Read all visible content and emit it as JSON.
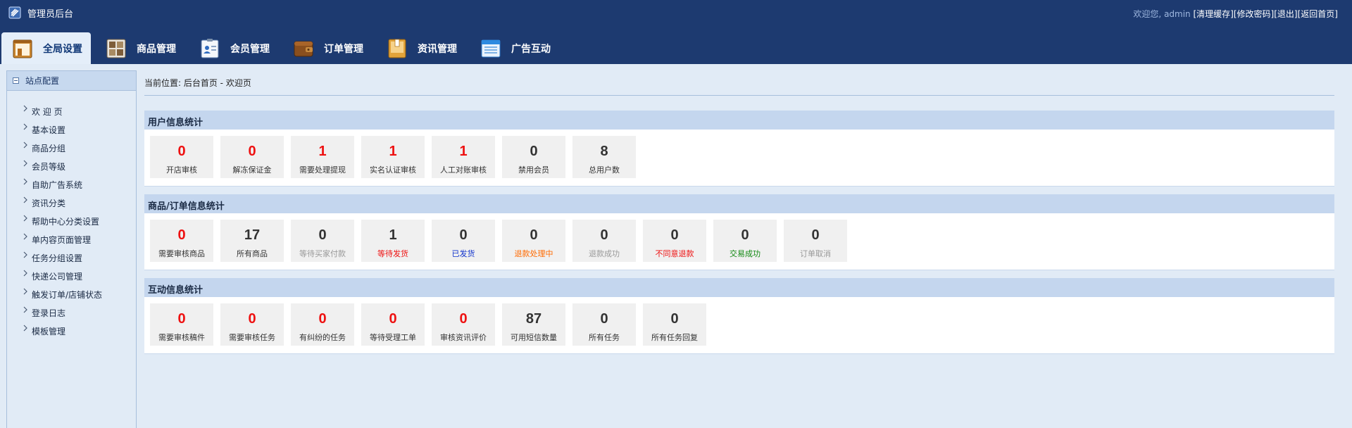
{
  "header": {
    "title": "管理员后台",
    "welcome_prefix": "欢迎您,",
    "username": "admin",
    "links": [
      {
        "label": "[清理缓存]"
      },
      {
        "label": "[修改密码]"
      },
      {
        "label": "[退出]"
      },
      {
        "label": "[返回首页]"
      }
    ]
  },
  "nav": {
    "tabs": [
      {
        "label": "全局设置",
        "icon": "global-settings-icon",
        "active": true
      },
      {
        "label": "商品管理",
        "icon": "product-grid-icon"
      },
      {
        "label": "会员管理",
        "icon": "member-card-icon"
      },
      {
        "label": "订单管理",
        "icon": "order-wallet-icon"
      },
      {
        "label": "资讯管理",
        "icon": "news-folder-icon"
      },
      {
        "label": "广告互动",
        "icon": "ad-window-icon"
      }
    ]
  },
  "sidebar": {
    "title": "站点配置",
    "items": [
      {
        "label": "欢 迎 页"
      },
      {
        "label": "基本设置"
      },
      {
        "label": "商品分组"
      },
      {
        "label": "会员等级"
      },
      {
        "label": "自助广告系统"
      },
      {
        "label": "资讯分类"
      },
      {
        "label": "帮助中心分类设置"
      },
      {
        "label": "单内容页面管理"
      },
      {
        "label": "任务分组设置"
      },
      {
        "label": "快递公司管理"
      },
      {
        "label": "触发订单/店铺状态"
      },
      {
        "label": "登录日志"
      },
      {
        "label": "模板管理"
      }
    ]
  },
  "breadcrumb": "当前位置: 后台首页 - 欢迎页",
  "colors": {
    "header_bg": "#1d3a70",
    "page_bg": "#e1ebf6",
    "panel_head_bg": "#c4d6ee",
    "num_red": "#ee1111",
    "num_dark": "#333333"
  },
  "panels": [
    {
      "title": "用户信息统计",
      "cards": [
        {
          "value": "0",
          "label": "开店审核",
          "num_color": "#ee1111",
          "label_color": "#333333"
        },
        {
          "value": "0",
          "label": "解冻保证金",
          "num_color": "#ee1111",
          "label_color": "#333333"
        },
        {
          "value": "1",
          "label": "需要处理提现",
          "num_color": "#ee1111",
          "label_color": "#333333"
        },
        {
          "value": "1",
          "label": "实名认证审核",
          "num_color": "#ee1111",
          "label_color": "#333333"
        },
        {
          "value": "1",
          "label": "人工对账审核",
          "num_color": "#ee1111",
          "label_color": "#333333"
        },
        {
          "value": "0",
          "label": "禁用会员",
          "num_color": "#333333",
          "label_color": "#333333"
        },
        {
          "value": "8",
          "label": "总用户数",
          "num_color": "#333333",
          "label_color": "#333333"
        }
      ]
    },
    {
      "title": "商品/订单信息统计",
      "cards": [
        {
          "value": "0",
          "label": "需要审核商品",
          "num_color": "#ee1111",
          "label_color": "#333333"
        },
        {
          "value": "17",
          "label": "所有商品",
          "num_color": "#333333",
          "label_color": "#333333"
        },
        {
          "value": "0",
          "label": "等待买家付款",
          "num_color": "#333333",
          "label_color": "#999999"
        },
        {
          "value": "1",
          "label": "等待发货",
          "num_color": "#333333",
          "label_color": "#ee1111"
        },
        {
          "value": "0",
          "label": "已发货",
          "num_color": "#333333",
          "label_color": "#1133cc"
        },
        {
          "value": "0",
          "label": "退款处理中",
          "num_color": "#333333",
          "label_color": "#ff6a00"
        },
        {
          "value": "0",
          "label": "退款成功",
          "num_color": "#333333",
          "label_color": "#999999"
        },
        {
          "value": "0",
          "label": "不同意退款",
          "num_color": "#333333",
          "label_color": "#ee1111"
        },
        {
          "value": "0",
          "label": "交易成功",
          "num_color": "#333333",
          "label_color": "#118811"
        },
        {
          "value": "0",
          "label": "订单取消",
          "num_color": "#333333",
          "label_color": "#999999"
        }
      ]
    },
    {
      "title": "互动信息统计",
      "cards": [
        {
          "value": "0",
          "label": "需要审核稿件",
          "num_color": "#ee1111",
          "label_color": "#333333"
        },
        {
          "value": "0",
          "label": "需要审核任务",
          "num_color": "#ee1111",
          "label_color": "#333333"
        },
        {
          "value": "0",
          "label": "有纠纷的任务",
          "num_color": "#ee1111",
          "label_color": "#333333"
        },
        {
          "value": "0",
          "label": "等待受理工单",
          "num_color": "#ee1111",
          "label_color": "#333333"
        },
        {
          "value": "0",
          "label": "审核资讯评价",
          "num_color": "#ee1111",
          "label_color": "#333333"
        },
        {
          "value": "87",
          "label": "可用短信数量",
          "num_color": "#333333",
          "label_color": "#333333"
        },
        {
          "value": "0",
          "label": "所有任务",
          "num_color": "#333333",
          "label_color": "#333333"
        },
        {
          "value": "0",
          "label": "所有任务回复",
          "num_color": "#333333",
          "label_color": "#333333"
        }
      ]
    }
  ]
}
